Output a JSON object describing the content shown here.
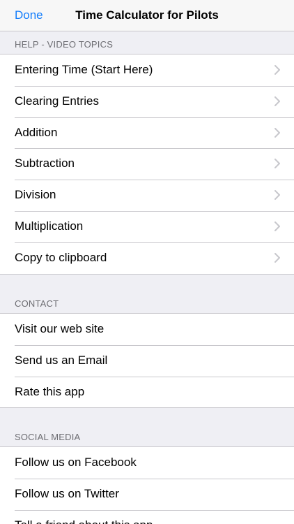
{
  "navbar": {
    "done_label": "Done",
    "title": "Time Calculator for Pilots"
  },
  "help": {
    "header": "HELP - VIDEO TOPICS",
    "items": [
      {
        "label": "Entering Time (Start Here)"
      },
      {
        "label": "Clearing Entries"
      },
      {
        "label": "Addition"
      },
      {
        "label": "Subtraction"
      },
      {
        "label": "Division"
      },
      {
        "label": "Multiplication"
      },
      {
        "label": "Copy to clipboard"
      }
    ]
  },
  "contact": {
    "header": "CONTACT",
    "items": [
      {
        "label": "Visit our web site"
      },
      {
        "label": "Send us an Email"
      },
      {
        "label": "Rate this app"
      }
    ]
  },
  "social": {
    "header": "SOCIAL MEDIA",
    "items": [
      {
        "label": "Follow us on Facebook"
      },
      {
        "label": "Follow us on Twitter"
      },
      {
        "label": "Tell a friend about this app"
      }
    ]
  },
  "colors": {
    "accent": "#157efb",
    "background": "#efeff4",
    "separator": "#c8c7cc",
    "chevron": "#c7c7cc"
  },
  "icons": {
    "chevron": "chevron-right-icon"
  }
}
